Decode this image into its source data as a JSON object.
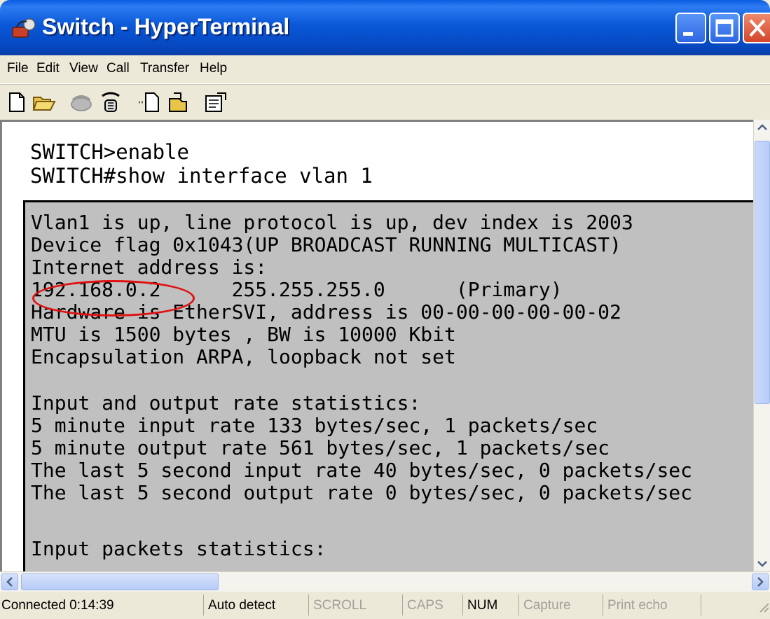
{
  "window": {
    "title": "Switch - HyperTerminal",
    "buttons": {
      "minimize": "minimize",
      "maximize": "maximize",
      "close": "close"
    }
  },
  "menu": [
    "File",
    "Edit",
    "View",
    "Call",
    "Transfer",
    "Help"
  ],
  "toolbar": {
    "icons": [
      "new-icon",
      "open-icon",
      "connect-icon",
      "disconnect-icon",
      "send-icon",
      "receive-icon",
      "properties-icon"
    ]
  },
  "terminal": {
    "commands": [
      "SWITCH>enable",
      "SWITCH#show interface vlan 1"
    ],
    "output": [
      "Vlan1 is up, line protocol is up, dev index is 2003",
      "Device flag 0x1043(UP BROADCAST RUNNING MULTICAST)",
      "Internet address is:",
      "192.168.0.2      255.255.255.0      (Primary)",
      "Hardware is EtherSVI, address is 00-00-00-00-00-02",
      "MTU is 1500 bytes , BW is 10000 Kbit",
      "Encapsulation ARPA, loopback not set",
      "",
      "Input and output rate statistics:",
      "5 minute input rate 133 bytes/sec, 1 packets/sec",
      "5 minute output rate 561 bytes/sec, 1 packets/sec",
      "The last 5 second input rate 40 bytes/sec, 0 packets/sec",
      "The last 5 second output rate 0 bytes/sec, 0 packets/sec",
      "",
      "Input packets statistics:"
    ],
    "highlight_color": "#E01010"
  },
  "status": {
    "connected": "Connected 0:14:39",
    "detect": "Auto detect",
    "scroll": "SCROLL",
    "caps": "CAPS",
    "num": "NUM",
    "capture": "Capture",
    "print_echo": "Print echo"
  }
}
